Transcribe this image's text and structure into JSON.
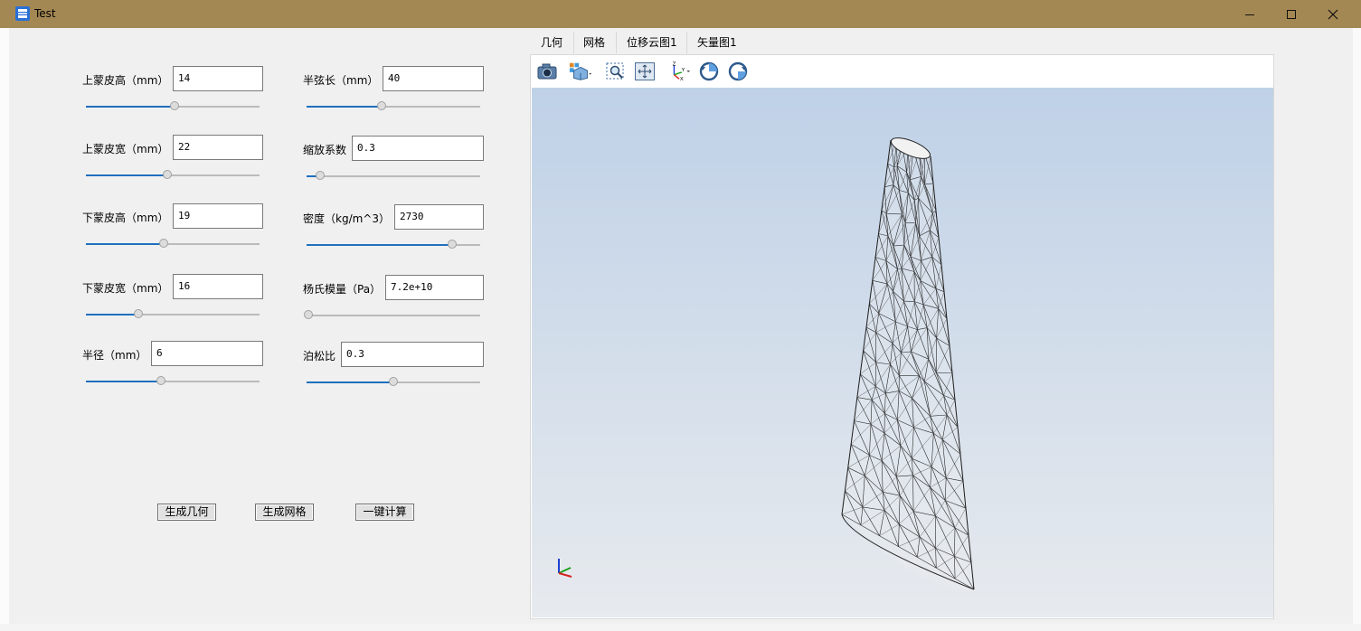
{
  "window": {
    "title": "Test",
    "controls": {
      "minimize": "minimize",
      "maximize": "maximize",
      "close": "close"
    }
  },
  "params": {
    "left": [
      {
        "label": "上蒙皮高（mm）",
        "value": "14",
        "slider_fraction": 0.51
      },
      {
        "label": "上蒙皮宽（mm）",
        "value": "22",
        "slider_fraction": 0.47
      },
      {
        "label": "下蒙皮高（mm）",
        "value": "19",
        "slider_fraction": 0.45
      },
      {
        "label": "下蒙皮宽（mm）",
        "value": "16",
        "slider_fraction": 0.3
      },
      {
        "label": "半径（mm）",
        "value": "6",
        "slider_fraction": 0.43
      }
    ],
    "right": [
      {
        "label": "半弦长（mm）",
        "value": "40",
        "slider_fraction": 0.43
      },
      {
        "label": "缩放系数",
        "value": "0.3",
        "slider_fraction": 0.08
      },
      {
        "label": "密度（kg/m^3）",
        "value": "2730",
        "slider_fraction": 0.84
      },
      {
        "label": "杨氏模量（Pa）",
        "value": "7.2e+10",
        "slider_fraction": 0.0
      },
      {
        "label": "泊松比",
        "value": "0.3",
        "slider_fraction": 0.5
      }
    ]
  },
  "actions": {
    "gen_geometry": "生成几何",
    "gen_mesh": "生成网格",
    "compute": "一键计算"
  },
  "tabs": [
    "几何",
    "网格",
    "位移云图1",
    "矢量图1"
  ],
  "toolbar": {
    "icons": [
      "camera-icon",
      "view-cube-icon",
      "zoom-box-icon",
      "fit-all-icon",
      "axes-orientation-icon",
      "rotate-ccw-icon",
      "rotate-cw-icon"
    ]
  },
  "viewer": {
    "background_top": "#bfd1e7",
    "background_bottom": "#e7eaee",
    "model": "wireframe-mesh-tapered-blade",
    "triad": [
      "x",
      "y",
      "z"
    ]
  },
  "colors": {
    "titlebar": "#a48853",
    "slider_fill": "#1f6fbf",
    "axis_x": "#d42020",
    "axis_y": "#1aa11a",
    "axis_z": "#1f3fd0"
  }
}
